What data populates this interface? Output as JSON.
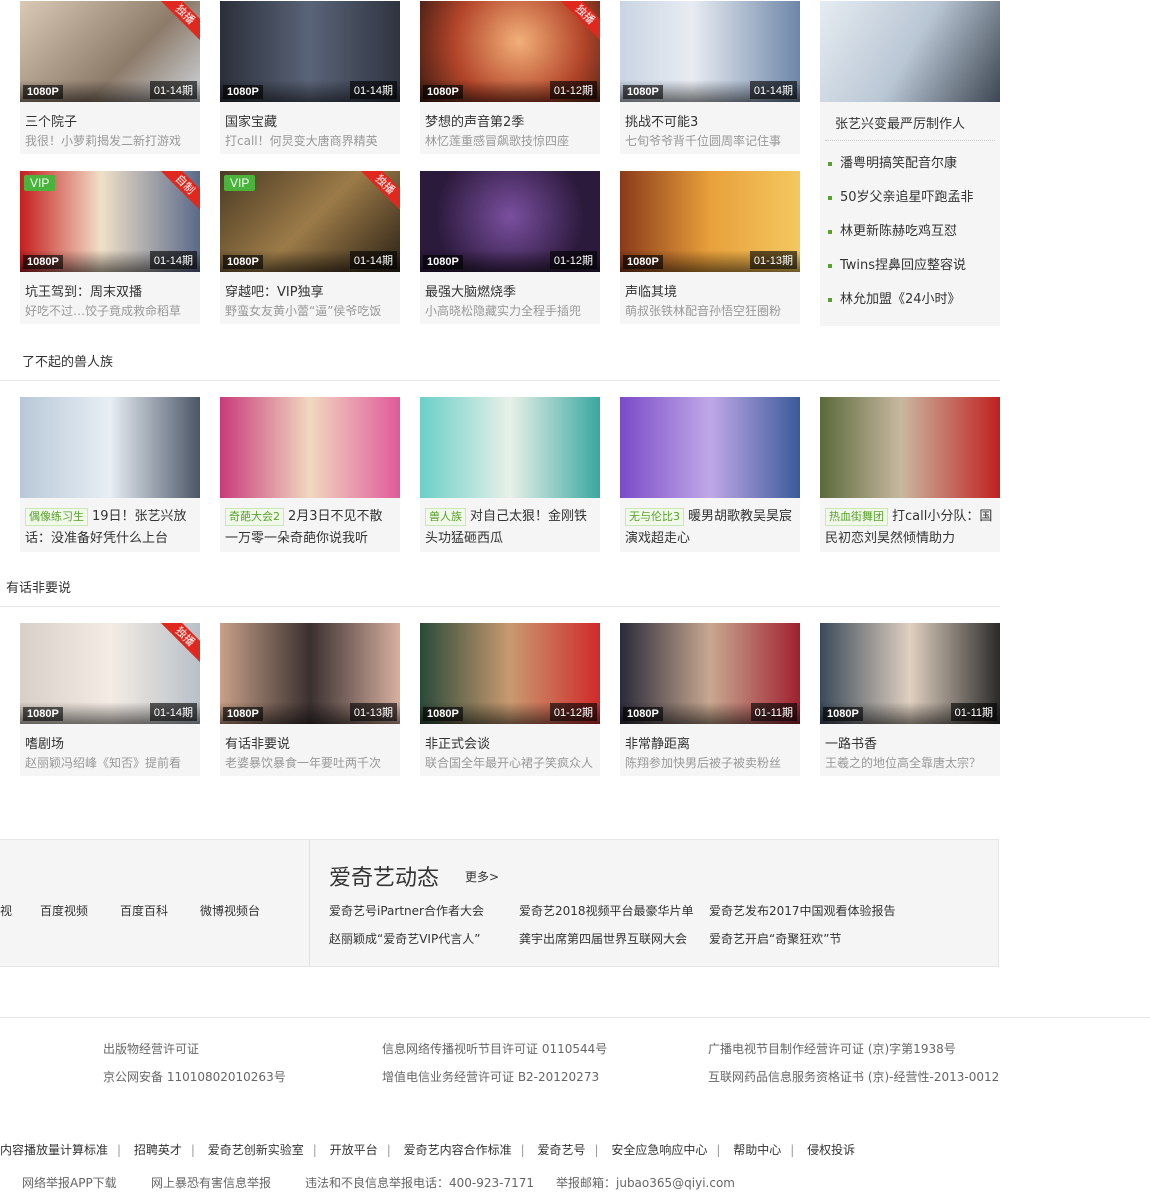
{
  "row1": [
    {
      "title": "三个院子",
      "desc": "我很！小萝莉揭发二新打游戏",
      "res": "1080P",
      "ep": "01-14期",
      "badge": "独播",
      "vip": ""
    },
    {
      "title": "国家宝藏",
      "desc": "打call！何炅变大唐商界精英",
      "res": "1080P",
      "ep": "01-14期",
      "badge": "",
      "vip": ""
    },
    {
      "title": "梦想的声音第2季",
      "desc": "林忆莲重感冒飙歌技惊四座",
      "res": "1080P",
      "ep": "01-12期",
      "badge": "独播",
      "vip": ""
    },
    {
      "title": "挑战不可能3",
      "desc": "七旬爷爷背千位圆周率记住事",
      "res": "1080P",
      "ep": "01-14期",
      "badge": "",
      "vip": ""
    }
  ],
  "row2": [
    {
      "title": "坑王驾到：周末双播",
      "desc": "好吃不过…饺子竟成救命稻草",
      "res": "1080P",
      "ep": "01-14期",
      "badge": "自制",
      "vip": "VIP"
    },
    {
      "title": "穿越吧：VIP独享",
      "desc": "野蛮女友黄小蕾“逼”侯爷吃饭",
      "res": "1080P",
      "ep": "01-14期",
      "badge": "独播",
      "vip": "VIP"
    },
    {
      "title": "最强大脑燃烧季",
      "desc": "小高晓松隐藏实力全程手插兜",
      "res": "1080P",
      "ep": "01-12期",
      "badge": "",
      "vip": ""
    },
    {
      "title": "声临其境",
      "desc": "萌叔张铁林配音孙悟空狂圈粉",
      "res": "1080P",
      "ep": "01-13期",
      "badge": "",
      "vip": ""
    }
  ],
  "sidebar": {
    "title": "张艺兴变最严厉制作人",
    "items": [
      "潘粤明搞笑配音尔康",
      "50岁父亲追星吓跑孟非",
      "林更新陈赫吃鸡互怼",
      "Twins捏鼻回应整容说",
      "林允加盟《24小时》"
    ]
  },
  "section1": {
    "title": "了不起的兽人族",
    "cards": [
      {
        "tag": "偶像练习生",
        "text": "19日！张艺兴放话：没准备好凭什么上台"
      },
      {
        "tag": "奇葩大会2",
        "text": "2月3日不见不散 一万零一朵奇葩你说我听"
      },
      {
        "tag": "兽人族",
        "text": "对自己太狠！金刚铁头功猛砸西瓜"
      },
      {
        "tag": "无与伦比3",
        "text": "暖男胡歌教吴昊宸演戏超走心"
      },
      {
        "tag": "热血街舞团",
        "text": "打call小分队：国民初恋刘昊然倾情助力"
      }
    ]
  },
  "section2": {
    "title": "有话非要说",
    "cards": [
      {
        "title": "嗜剧场",
        "desc": "赵丽颖冯绍峰《知否》提前看",
        "res": "1080P",
        "ep": "01-14期",
        "badge": "独播"
      },
      {
        "title": "有话非要说",
        "desc": "老婆暴饮暴食一年要吐两千次",
        "res": "1080P",
        "ep": "01-13期",
        "badge": ""
      },
      {
        "title": "非正式会谈",
        "desc": "联合国全年最开心裙子笑疯众人",
        "res": "1080P",
        "ep": "01-12期",
        "badge": ""
      },
      {
        "title": "非常静距离",
        "desc": "陈翔参加快男后被子被卖粉丝",
        "res": "1080P",
        "ep": "01-11期",
        "badge": ""
      },
      {
        "title": "一路书香",
        "desc": "王羲之的地位高全靠唐太宗？",
        "res": "1080P",
        "ep": "01-11期",
        "badge": ""
      }
    ]
  },
  "partners": [
    "视",
    "百度视频",
    "百度百科",
    "微博视频台"
  ],
  "dynamics": {
    "title": "爱奇艺动态",
    "more": "更多>",
    "items": [
      "爱奇艺号iPartner合作者大会",
      "爱奇艺2018视频平台最豪华片单",
      "爱奇艺发布2017中国观看体验报告",
      "赵丽颖成“爱奇艺VIP代言人”",
      "龚宇出席第四届世界互联网大会",
      "爱奇艺开启“奇聚狂欢”节"
    ]
  },
  "licenses": [
    "出版物经营许可证",
    "信息网络传播视听节目许可证 0110544号",
    "广播电视节目制作经营许可证 (京)字第1938号",
    "京公网安备 11010802010263号",
    "增值电信业务经营许可证 B2-20120273",
    "互联网药品信息服务资格证书 (京)-经营性-2013-0012"
  ],
  "bottom_links": [
    "内容播放量计算标准",
    "招聘英才",
    "爱奇艺创新实验室",
    "开放平台",
    "爱奇艺内容合作标准",
    "爱奇艺号",
    "安全应急响应中心",
    "帮助中心",
    "侵权投诉"
  ],
  "report": [
    "网络举报APP下载",
    "网上暴恐有害信息举报",
    "违法和不良信息举报电话：400-923-7171",
    "举报邮箱：jubao365@qiyi.com"
  ],
  "colors": {
    "accent": "#5aa02c",
    "badge_red": "#e0281f",
    "vip_green": "#4ab33b"
  }
}
